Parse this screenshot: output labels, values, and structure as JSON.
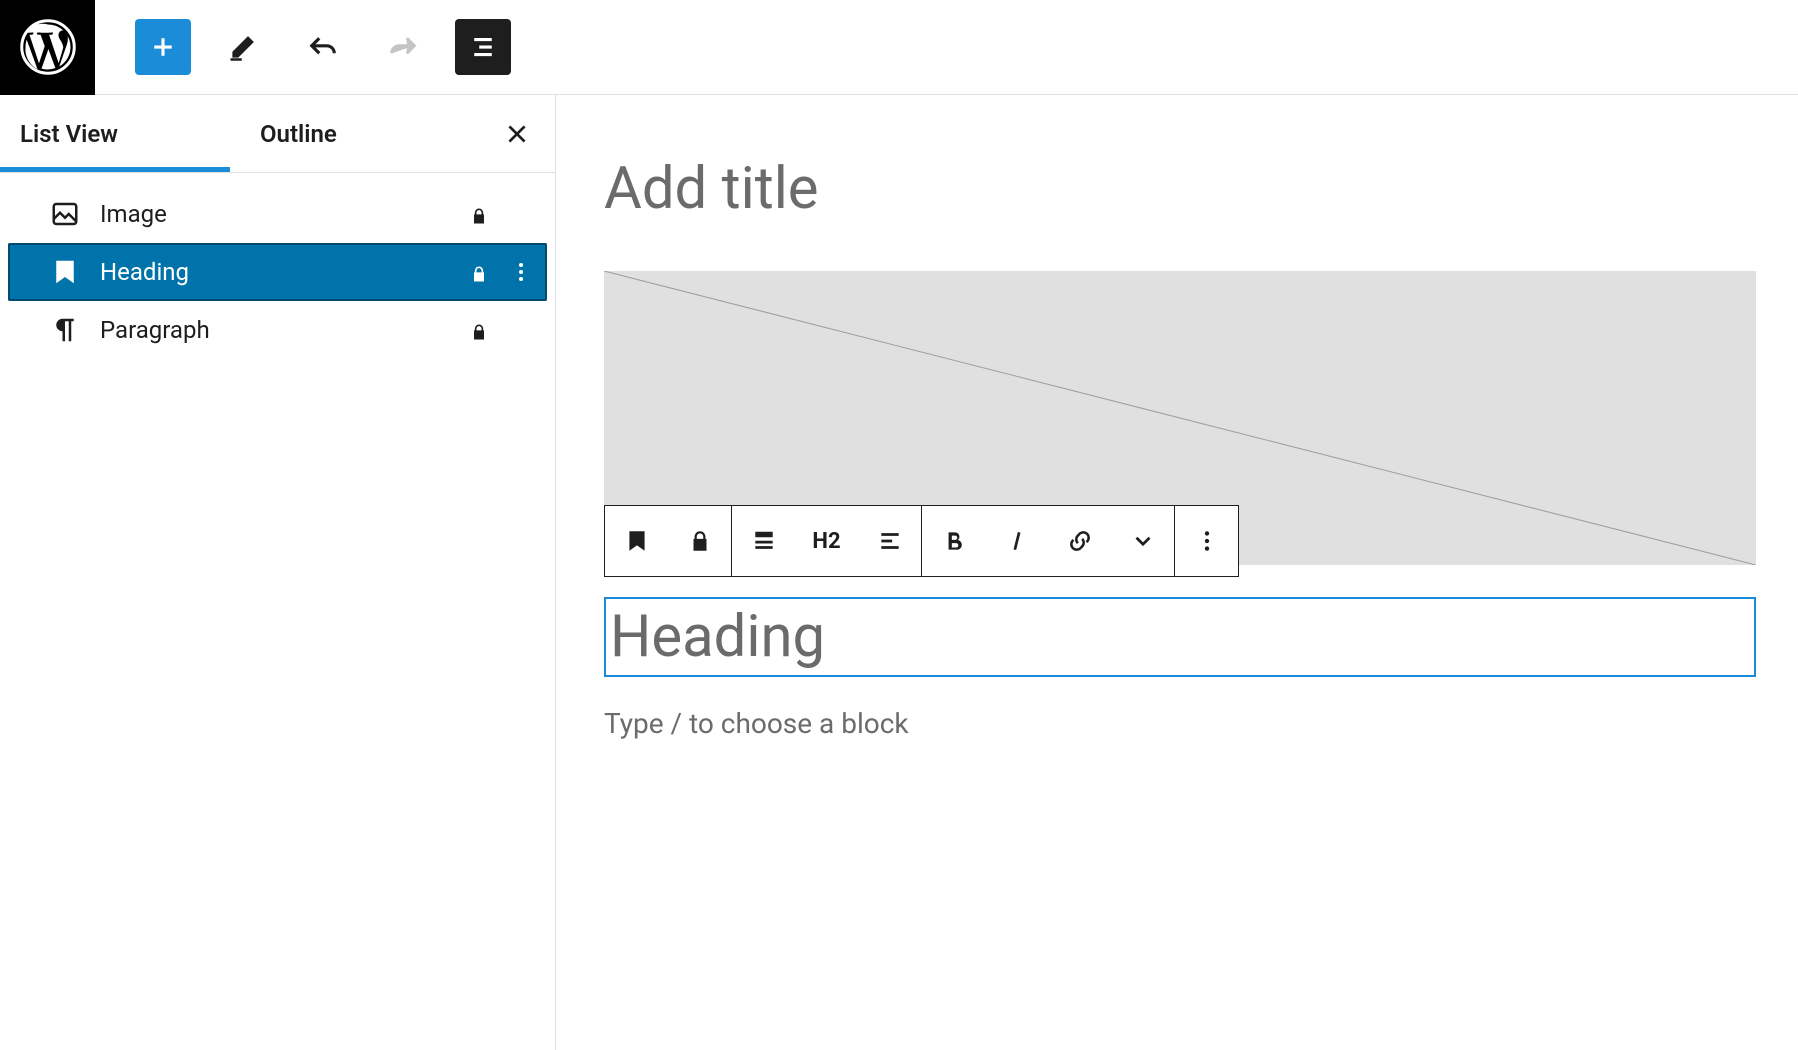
{
  "topbar": {},
  "sidebar": {
    "tabs": {
      "list_view": "List View",
      "outline": "Outline"
    },
    "items": [
      {
        "label": "Image",
        "icon": "image",
        "locked": true,
        "selected": false
      },
      {
        "label": "Heading",
        "icon": "heading",
        "locked": true,
        "selected": true
      },
      {
        "label": "Paragraph",
        "icon": "paragraph",
        "locked": true,
        "selected": false
      }
    ]
  },
  "canvas": {
    "title_placeholder": "Add title",
    "heading_placeholder": "Heading",
    "paragraph_placeholder": "Type / to choose a block"
  },
  "block_toolbar": {
    "heading_level": "H2"
  }
}
